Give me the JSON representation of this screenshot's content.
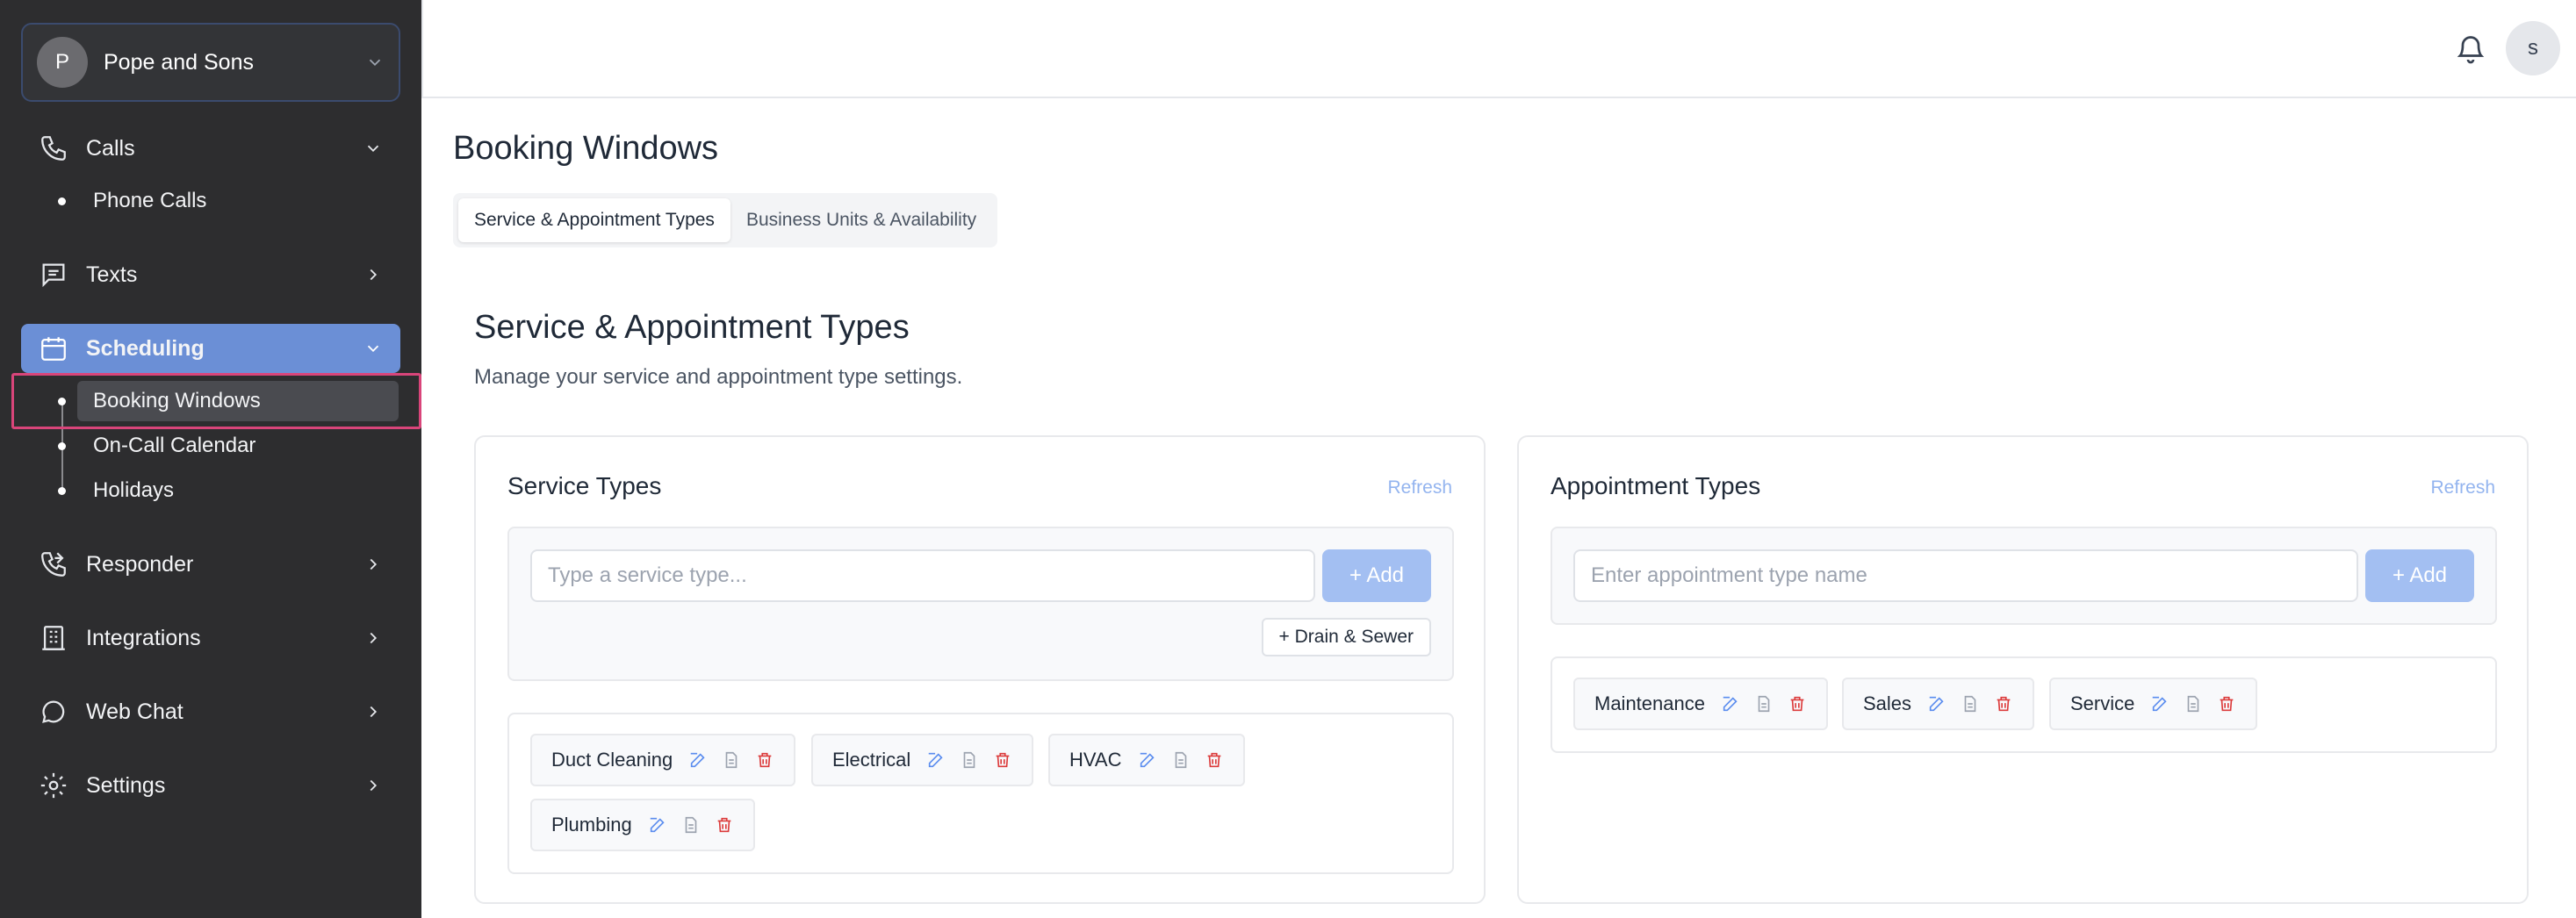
{
  "sidebar": {
    "org": {
      "initial": "P",
      "name": "Pope and Sons"
    },
    "nav": {
      "calls": "Calls",
      "phone_calls": "Phone Calls",
      "texts": "Texts",
      "scheduling": "Scheduling",
      "booking_windows": "Booking Windows",
      "on_call_calendar": "On-Call Calendar",
      "holidays": "Holidays",
      "responder": "Responder",
      "integrations": "Integrations",
      "web_chat": "Web Chat",
      "settings": "Settings"
    }
  },
  "header": {
    "user_initial": "s"
  },
  "page": {
    "title": "Booking Windows",
    "tabs": [
      "Service & Appointment Types",
      "Business Units & Availability"
    ],
    "section_title": "Service & Appointment Types",
    "section_subtitle": "Manage your service and appointment type settings."
  },
  "service_types": {
    "title": "Service Types",
    "refresh": "Refresh",
    "input_placeholder": "Type a service type...",
    "add": "+ Add",
    "suggestion": "+ Drain & Sewer",
    "items": [
      "Duct Cleaning",
      "Electrical",
      "HVAC",
      "Plumbing"
    ]
  },
  "appointment_types": {
    "title": "Appointment Types",
    "refresh": "Refresh",
    "input_placeholder": "Enter appointment type name",
    "add": "+ Add",
    "items": [
      "Maintenance",
      "Sales",
      "Service"
    ]
  },
  "colors": {
    "sidebar_bg": "#2d2d2f",
    "active_nav": "#6b8fd6",
    "edit_icon": "#5b8def",
    "delete_icon": "#dc3b3b",
    "highlight": "#d9457a"
  }
}
